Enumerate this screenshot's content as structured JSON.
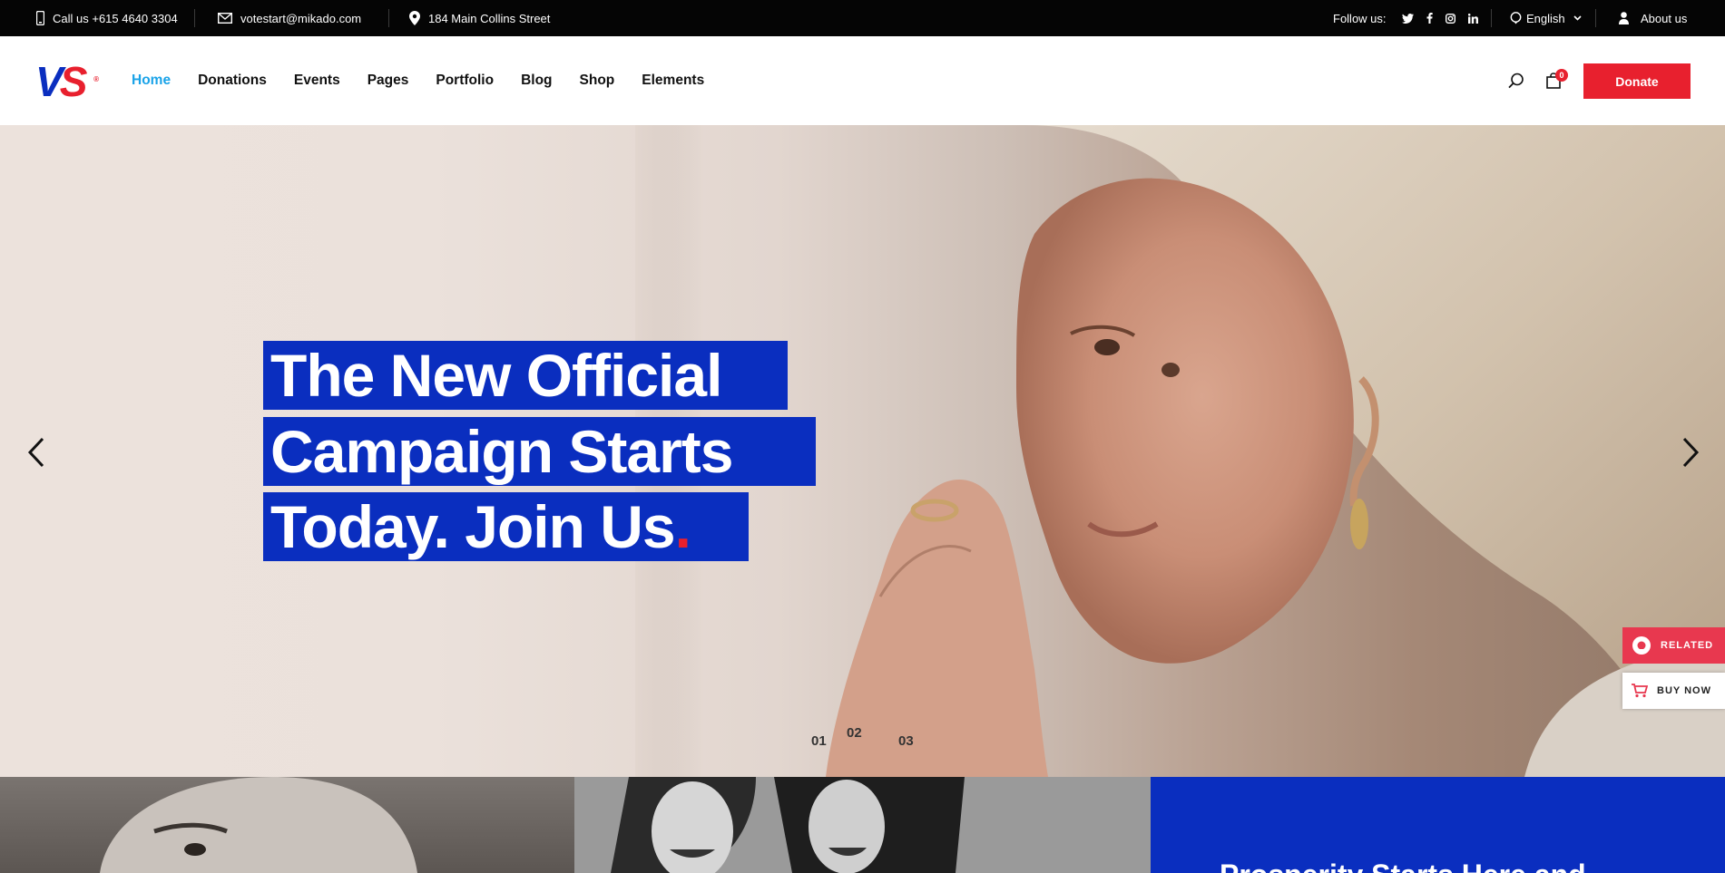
{
  "topbar": {
    "phone": "Call us +615 4640 3304",
    "email": "votestart@mikado.com",
    "address": "184 Main Collins Street",
    "follow_label": "Follow us:",
    "social": [
      "twitter-icon",
      "facebook-icon",
      "instagram-icon",
      "linkedin-icon"
    ],
    "language": "English",
    "about": "About us"
  },
  "header": {
    "logo_text_v": "V",
    "logo_text_s": "S",
    "logo_reg": "®",
    "nav": [
      "Home",
      "Donations",
      "Events",
      "Pages",
      "Portfolio",
      "Blog",
      "Shop",
      "Elements"
    ],
    "active_nav": "Home",
    "cart_count": "0",
    "donate_label": "Donate"
  },
  "hero": {
    "headline_lines": [
      "The New Official",
      "Campaign Starts",
      "Today. Join Us"
    ],
    "headline_dot": ".",
    "slides": [
      "01",
      "02",
      "03"
    ],
    "active_slide": "02"
  },
  "side_tabs": {
    "related": "RELATED",
    "buy_now": "BUY NOW"
  },
  "bottom": {
    "title_partial": "Prosperity Starts Here and"
  },
  "colors": {
    "brand_blue": "#0a2ebf",
    "brand_red": "#e8202e",
    "active_link": "#1aa3e8",
    "topbar_bg": "#050505"
  }
}
